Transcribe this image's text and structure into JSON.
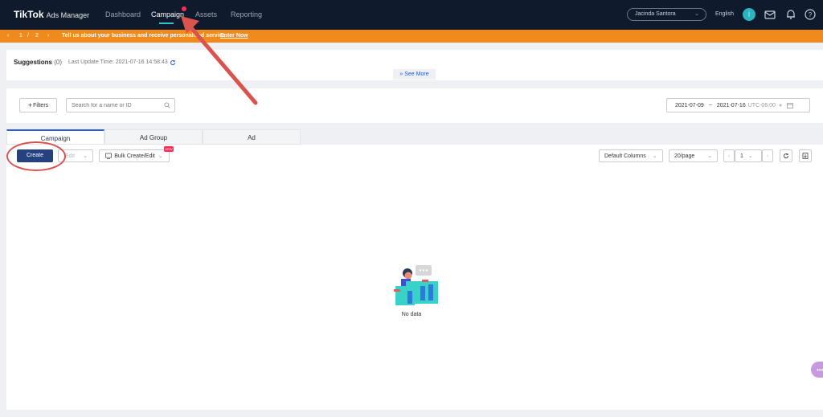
{
  "header": {
    "logo": "TikTok",
    "logo_sub": "Ads Manager",
    "nav": [
      "Dashboard",
      "Campaign",
      "Assets",
      "Reporting"
    ],
    "account": "Jacinda Santora",
    "language": "English",
    "avatar_initial": "j"
  },
  "banner": {
    "prev": "‹",
    "page": "1",
    "sep": "/",
    "total": "2",
    "next": "›",
    "message": "Tell us about your business and receive personalized service.",
    "link": "Enter Now"
  },
  "suggestions": {
    "title": "Suggestions",
    "count": "(0)",
    "update": "Last Update Time: 2021-07-16 14:58:43",
    "see_more": "See More"
  },
  "filters": {
    "button": "Filters",
    "search_placeholder": "Search for a name or ID",
    "date_start": "2021-07-09",
    "date_sep": "~",
    "date_end": "2021-07-16",
    "timezone": "UTC-06:00"
  },
  "tabs": [
    "Campaign",
    "Ad Group",
    "Ad"
  ],
  "toolbar": {
    "create": "Create",
    "edit": "Edit",
    "bulk": "Bulk Create/Edit",
    "new_badge": "NEW",
    "columns": "Default Columns",
    "per_page": "20/page",
    "page": "1"
  },
  "empty": {
    "text": "No data"
  },
  "colors": {
    "topbar": "#0f1b2d",
    "banner": "#f08a1c",
    "primary": "#25427f",
    "accent": "#3ac0c9",
    "annotation": "#d9534f"
  }
}
